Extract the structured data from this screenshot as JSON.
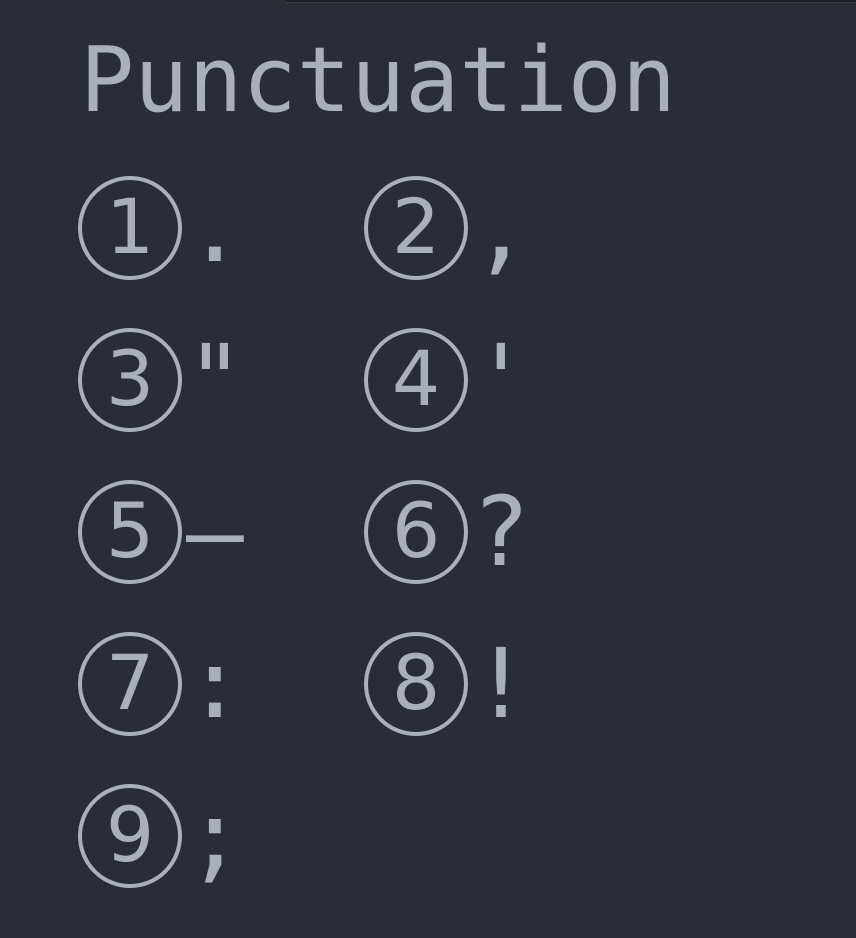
{
  "title": "Punctuation",
  "items": [
    {
      "number": "1",
      "mark": "."
    },
    {
      "number": "2",
      "mark": ","
    },
    {
      "number": "3",
      "mark": "\""
    },
    {
      "number": "4",
      "mark": "'"
    },
    {
      "number": "5",
      "mark": "–"
    },
    {
      "number": "6",
      "mark": "?"
    },
    {
      "number": "7",
      "mark": ":"
    },
    {
      "number": "8",
      "mark": "!"
    },
    {
      "number": "9",
      "mark": ";"
    }
  ],
  "colors": {
    "background": "#2a2d35",
    "text": "#a9afbb"
  }
}
